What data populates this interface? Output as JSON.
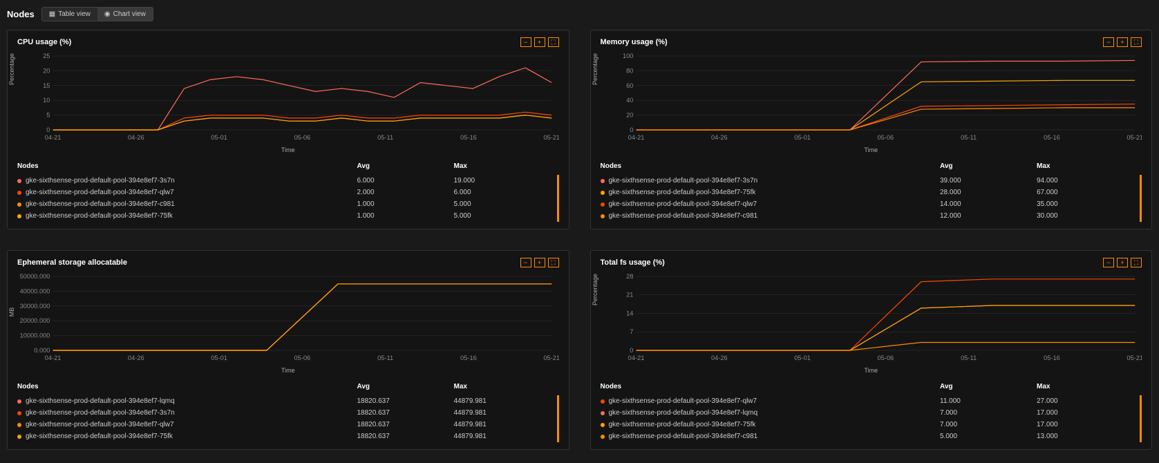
{
  "page_title": "Nodes",
  "view_toggle": {
    "table": "Table view",
    "chart": "Chart view"
  },
  "xlabel": "Time",
  "table_headers": {
    "nodes": "Nodes",
    "avg": "Avg",
    "max": "Max"
  },
  "x_ticks": [
    "04-21",
    "04-26",
    "05-01",
    "05-06",
    "05-11",
    "05-16",
    "05-21"
  ],
  "colors": {
    "c1": "#ff6b5b",
    "c2": "#ff4500",
    "c3": "#ff8c00",
    "c4": "#ffa500"
  },
  "panels": [
    {
      "title": "CPU usage (%)",
      "ylabel": "Percentage",
      "ylim": [
        0,
        25
      ],
      "yticks": [
        0,
        5,
        10,
        15,
        20,
        25
      ],
      "rows": [
        {
          "name": "gke-sixthsense-prod-default-pool-394e8ef7-3s7n",
          "avg": "6.000",
          "max": "19.000",
          "color": "c1"
        },
        {
          "name": "gke-sixthsense-prod-default-pool-394e8ef7-qlw7",
          "avg": "2.000",
          "max": "6.000",
          "color": "c2"
        },
        {
          "name": "gke-sixthsense-prod-default-pool-394e8ef7-c981",
          "avg": "1.000",
          "max": "5.000",
          "color": "c3"
        },
        {
          "name": "gke-sixthsense-prod-default-pool-394e8ef7-75fk",
          "avg": "1.000",
          "max": "5.000",
          "color": "c4"
        }
      ]
    },
    {
      "title": "Memory usage (%)",
      "ylabel": "Percentage",
      "ylim": [
        0,
        100
      ],
      "yticks": [
        0,
        20,
        40,
        60,
        80,
        100
      ],
      "rows": [
        {
          "name": "gke-sixthsense-prod-default-pool-394e8ef7-3s7n",
          "avg": "39.000",
          "max": "94.000",
          "color": "c1"
        },
        {
          "name": "gke-sixthsense-prod-default-pool-394e8ef7-75fk",
          "avg": "28.000",
          "max": "67.000",
          "color": "c4"
        },
        {
          "name": "gke-sixthsense-prod-default-pool-394e8ef7-qlw7",
          "avg": "14.000",
          "max": "35.000",
          "color": "c2"
        },
        {
          "name": "gke-sixthsense-prod-default-pool-394e8ef7-c981",
          "avg": "12.000",
          "max": "30.000",
          "color": "c3"
        }
      ]
    },
    {
      "title": "Ephemeral storage allocatable",
      "ylabel": "MB",
      "ylim": [
        0,
        50000
      ],
      "yticks": [
        "0.000",
        "10000.000",
        "20000.000",
        "30000.000",
        "40000.000",
        "50000.000"
      ],
      "rows": [
        {
          "name": "gke-sixthsense-prod-default-pool-394e8ef7-lqmq",
          "avg": "18820.637",
          "max": "44879.981",
          "color": "c1"
        },
        {
          "name": "gke-sixthsense-prod-default-pool-394e8ef7-3s7n",
          "avg": "18820.637",
          "max": "44879.981",
          "color": "c2"
        },
        {
          "name": "gke-sixthsense-prod-default-pool-394e8ef7-qlw7",
          "avg": "18820.637",
          "max": "44879.981",
          "color": "c3"
        },
        {
          "name": "gke-sixthsense-prod-default-pool-394e8ef7-75fk",
          "avg": "18820.637",
          "max": "44879.981",
          "color": "c4"
        }
      ]
    },
    {
      "title": "Total fs usage (%)",
      "ylabel": "Percentage",
      "ylim": [
        0,
        28
      ],
      "yticks": [
        0,
        7,
        14,
        21,
        28
      ],
      "rows": [
        {
          "name": "gke-sixthsense-prod-default-pool-394e8ef7-qlw7",
          "avg": "11.000",
          "max": "27.000",
          "color": "c2"
        },
        {
          "name": "gke-sixthsense-prod-default-pool-394e8ef7-lqmq",
          "avg": "7.000",
          "max": "17.000",
          "color": "c1"
        },
        {
          "name": "gke-sixthsense-prod-default-pool-394e8ef7-75fk",
          "avg": "7.000",
          "max": "17.000",
          "color": "c4"
        },
        {
          "name": "gke-sixthsense-prod-default-pool-394e8ef7-c981",
          "avg": "5.000",
          "max": "13.000",
          "color": "c3"
        }
      ]
    }
  ],
  "chart_data": [
    {
      "type": "line",
      "title": "CPU usage (%)",
      "xlabel": "Time",
      "ylabel": "Percentage",
      "x": [
        "04-21",
        "04-26",
        "05-01",
        "05-06",
        "05-07",
        "05-08",
        "05-09",
        "05-10",
        "05-11",
        "05-12",
        "05-13",
        "05-14",
        "05-15",
        "05-16",
        "05-17",
        "05-18",
        "05-19",
        "05-20",
        "05-21"
      ],
      "ylim": [
        0,
        25
      ],
      "series": [
        {
          "name": "gke-sixthsense-prod-default-pool-394e8ef7-3s7n",
          "color": "#ff6b5b",
          "values": [
            0,
            0,
            0,
            0,
            0,
            14,
            17,
            18,
            17,
            15,
            13,
            14,
            13,
            11,
            16,
            15,
            14,
            18,
            21,
            16
          ]
        },
        {
          "name": "gke-sixthsense-prod-default-pool-394e8ef7-qlw7",
          "color": "#ff4500",
          "values": [
            0,
            0,
            0,
            0,
            0,
            4,
            5,
            5,
            5,
            4,
            4,
            5,
            4,
            4,
            5,
            5,
            5,
            5,
            6,
            5
          ]
        },
        {
          "name": "gke-sixthsense-prod-default-pool-394e8ef7-c981",
          "color": "#ff8c00",
          "values": [
            0,
            0,
            0,
            0,
            0,
            3,
            4,
            4,
            4,
            3,
            3,
            4,
            3,
            3,
            4,
            4,
            4,
            4,
            5,
            4
          ]
        },
        {
          "name": "gke-sixthsense-prod-default-pool-394e8ef7-75fk",
          "color": "#ffa500",
          "values": [
            0,
            0,
            0,
            0,
            0,
            3,
            4,
            4,
            4,
            3,
            3,
            4,
            3,
            3,
            4,
            4,
            4,
            4,
            5,
            4
          ]
        }
      ]
    },
    {
      "type": "line",
      "title": "Memory usage (%)",
      "xlabel": "Time",
      "ylabel": "Percentage",
      "x": [
        "04-21",
        "04-26",
        "05-01",
        "05-06",
        "05-08",
        "05-11",
        "05-16",
        "05-21"
      ],
      "ylim": [
        0,
        100
      ],
      "series": [
        {
          "name": "gke-sixthsense-prod-default-pool-394e8ef7-3s7n",
          "color": "#ff6b5b",
          "values": [
            0,
            0,
            0,
            0,
            92,
            93,
            93,
            94
          ]
        },
        {
          "name": "gke-sixthsense-prod-default-pool-394e8ef7-75fk",
          "color": "#ffa500",
          "values": [
            0,
            0,
            0,
            0,
            65,
            66,
            67,
            67
          ]
        },
        {
          "name": "gke-sixthsense-prod-default-pool-394e8ef7-qlw7",
          "color": "#ff4500",
          "values": [
            0,
            0,
            0,
            0,
            32,
            33,
            34,
            35
          ]
        },
        {
          "name": "gke-sixthsense-prod-default-pool-394e8ef7-c981",
          "color": "#ff8c00",
          "values": [
            0,
            0,
            0,
            0,
            28,
            29,
            30,
            30
          ]
        }
      ]
    },
    {
      "type": "line",
      "title": "Ephemeral storage allocatable",
      "xlabel": "Time",
      "ylabel": "MB",
      "x": [
        "04-21",
        "04-26",
        "05-01",
        "05-06",
        "05-08",
        "05-11",
        "05-16",
        "05-21"
      ],
      "ylim": [
        0,
        50000
      ],
      "series": [
        {
          "name": "gke-sixthsense-prod-default-pool-394e8ef7-lqmq",
          "color": "#ff6b5b",
          "values": [
            0,
            0,
            0,
            0,
            44880,
            44880,
            44880,
            44880
          ]
        },
        {
          "name": "gke-sixthsense-prod-default-pool-394e8ef7-3s7n",
          "color": "#ff4500",
          "values": [
            0,
            0,
            0,
            0,
            44880,
            44880,
            44880,
            44880
          ]
        },
        {
          "name": "gke-sixthsense-prod-default-pool-394e8ef7-qlw7",
          "color": "#ff8c00",
          "values": [
            0,
            0,
            0,
            0,
            44880,
            44880,
            44880,
            44880
          ]
        },
        {
          "name": "gke-sixthsense-prod-default-pool-394e8ef7-75fk",
          "color": "#ffa500",
          "values": [
            0,
            0,
            0,
            0,
            44880,
            44880,
            44880,
            44880
          ]
        }
      ]
    },
    {
      "type": "line",
      "title": "Total fs usage (%)",
      "xlabel": "Time",
      "ylabel": "Percentage",
      "x": [
        "04-21",
        "04-26",
        "05-01",
        "05-06",
        "05-08",
        "05-11",
        "05-16",
        "05-21"
      ],
      "ylim": [
        0,
        28
      ],
      "series": [
        {
          "name": "gke-sixthsense-prod-default-pool-394e8ef7-qlw7",
          "color": "#ff4500",
          "values": [
            0,
            0,
            0,
            0,
            26,
            27,
            27,
            27
          ]
        },
        {
          "name": "gke-sixthsense-prod-default-pool-394e8ef7-lqmq",
          "color": "#ff6b5b",
          "values": [
            0,
            0,
            0,
            0,
            16,
            17,
            17,
            17
          ]
        },
        {
          "name": "gke-sixthsense-prod-default-pool-394e8ef7-75fk",
          "color": "#ffa500",
          "values": [
            0,
            0,
            0,
            0,
            16,
            17,
            17,
            17
          ]
        },
        {
          "name": "gke-sixthsense-prod-default-pool-394e8ef7-c981",
          "color": "#ff8c00",
          "values": [
            0,
            0,
            0,
            0,
            3,
            3,
            3,
            3
          ]
        }
      ]
    }
  ]
}
